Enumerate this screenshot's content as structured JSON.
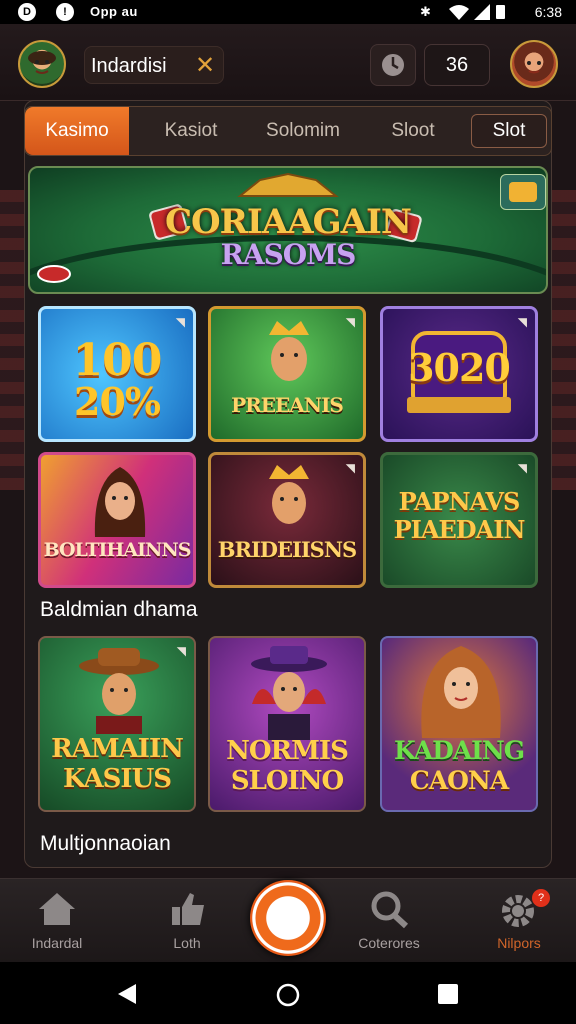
{
  "status_bar": {
    "app_name": "Opp au",
    "time": "6:38"
  },
  "header": {
    "username": "Indardisi",
    "coins": "36"
  },
  "tabs": [
    {
      "label": "Kasimo"
    },
    {
      "label": "Kasiot"
    },
    {
      "label": "Solomim"
    },
    {
      "label": "Sloot"
    },
    {
      "label": "Slot"
    }
  ],
  "banner": {
    "title_line1": "CORIAAGAIN",
    "title_line2": "RASOMS"
  },
  "grid1": [
    {
      "label_top": "100",
      "label_bottom": "20%"
    },
    {
      "label": "PREEANIS"
    },
    {
      "label": "3020"
    },
    {
      "label": "BOLTIHAINNS"
    },
    {
      "label": "BRIDEIISNS"
    },
    {
      "label_top": "PAPNAVS",
      "label_bottom": "PIAEDAIN"
    }
  ],
  "section1_title": "Baldmian dhama",
  "grid2": [
    {
      "label_top": "RAMAIIN",
      "label_bottom": "KASIUS"
    },
    {
      "label_top": "NORMIS",
      "label_bottom": "SLOINO"
    },
    {
      "label_top": "KADAING",
      "label_bottom": "CAONA"
    }
  ],
  "section2_title": "Multjonnaoian",
  "bottom_nav": [
    {
      "label": "Indardal"
    },
    {
      "label": "Loth"
    },
    {
      "label": "Coterores"
    },
    {
      "label": "Nilpors",
      "badge": "?"
    }
  ],
  "colors": {
    "accent": "#ef6a1c",
    "gold": "#f6c64a",
    "background": "#1c1416"
  }
}
